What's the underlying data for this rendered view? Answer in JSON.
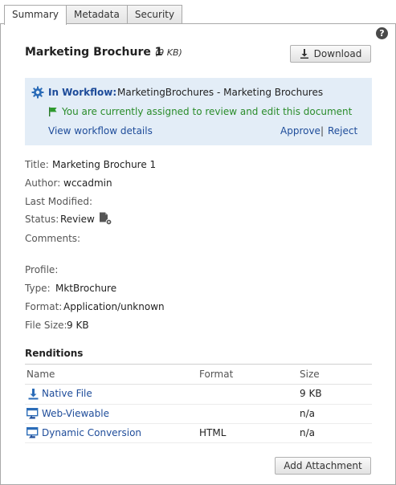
{
  "tabs": [
    {
      "label": "Summary"
    },
    {
      "label": "Metadata"
    },
    {
      "label": "Security"
    }
  ],
  "help_icon": "question-icon",
  "document": {
    "title": "Marketing Brochure 1",
    "size": "(9 KB)"
  },
  "toolbar": {
    "download_label": "Download"
  },
  "workflow": {
    "label": "In Workflow:",
    "name": "MarketingBrochures - Marketing Brochures",
    "assigned_text": "You are currently assigned to review and edit this document",
    "details_link": "View workflow details",
    "approve_link": "Approve",
    "separator": "|",
    "reject_link": "Reject"
  },
  "info": {
    "title_label": "Title:",
    "title_value": "Marketing Brochure 1",
    "author_label": "Author:",
    "author_value": "wccadmin",
    "last_modified_label": "Last Modified:",
    "status_label": "Status:",
    "status_value": "Review",
    "comments_label": "Comments:",
    "profile_label": "Profile:",
    "type_label": "Type:",
    "type_value": "MktBrochure",
    "format_label": "Format:",
    "format_value": "Application/unknown",
    "file_size_label": "File Size:",
    "file_size_value": "9 KB"
  },
  "renditions": {
    "heading": "Renditions",
    "columns": {
      "name": "Name",
      "format": "Format",
      "size": "Size"
    },
    "rows": [
      {
        "name": "Native File",
        "format": "",
        "size": "9 KB",
        "icon": "download-icon"
      },
      {
        "name": "Web-Viewable",
        "format": "",
        "size": "n/a",
        "icon": "web-view-icon"
      },
      {
        "name": "Dynamic Conversion",
        "format": "HTML",
        "size": "n/a",
        "icon": "web-view-icon"
      }
    ]
  },
  "footer": {
    "add_attachment_label": "Add Attachment"
  },
  "colors": {
    "accent": "#1e4c9a",
    "workflow_bg": "#e3edf7",
    "assigned_green": "#2a8c2a"
  }
}
